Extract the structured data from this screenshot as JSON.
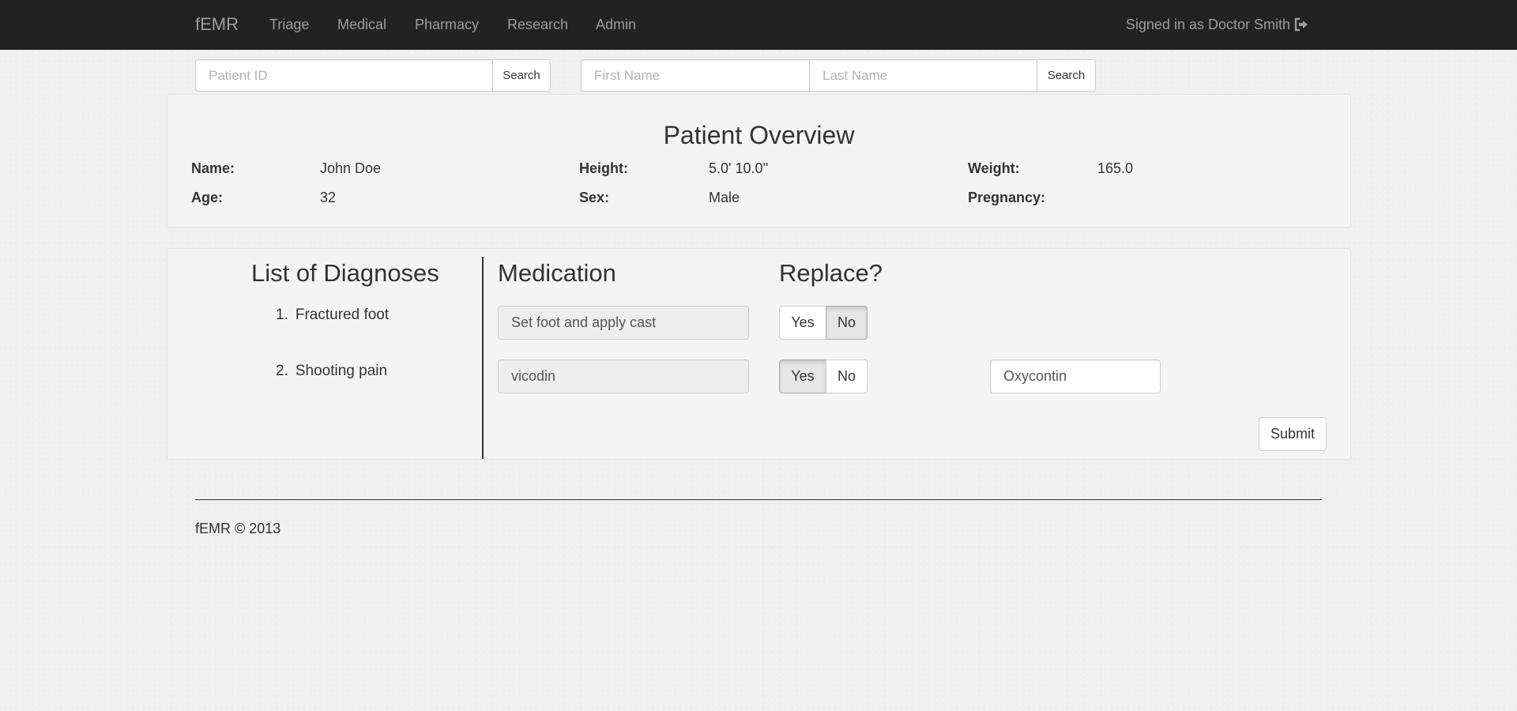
{
  "navbar": {
    "brand": "fEMR",
    "links": [
      "Triage",
      "Medical",
      "Pharmacy",
      "Research",
      "Admin"
    ],
    "signed_in": "Signed in as Doctor Smith",
    "signout_icon": "sign-out-icon"
  },
  "search": {
    "patient_id_placeholder": "Patient ID",
    "search_label": "Search",
    "first_name_placeholder": "First Name",
    "last_name_placeholder": "Last Name",
    "search_label_2": "Search"
  },
  "overview": {
    "title": "Patient Overview",
    "name_label": "Name:",
    "name_value": "John Doe",
    "age_label": "Age:",
    "age_value": "32",
    "height_label": "Height:",
    "height_value": "5.0' 10.0''",
    "sex_label": "Sex:",
    "sex_value": "Male",
    "weight_label": "Weight:",
    "weight_value": "165.0",
    "pregnancy_label": "Pregnancy:",
    "pregnancy_value": ""
  },
  "diagnoses": {
    "heading": "List of Diagnoses",
    "medication_heading": "Medication",
    "replace_heading": "Replace?",
    "items": [
      {
        "number": "1.",
        "diagnosis": "Fractured foot",
        "medication": "Set foot and apply cast",
        "yes_label": "Yes",
        "no_label": "No",
        "selected": "No",
        "replacement": ""
      },
      {
        "number": "2.",
        "diagnosis": "Shooting pain",
        "medication": "vicodin",
        "yes_label": "Yes",
        "no_label": "No",
        "selected": "Yes",
        "replacement": "Oxycontin"
      }
    ],
    "submit_label": "Submit"
  },
  "footer": {
    "text": "fEMR © 2013"
  }
}
